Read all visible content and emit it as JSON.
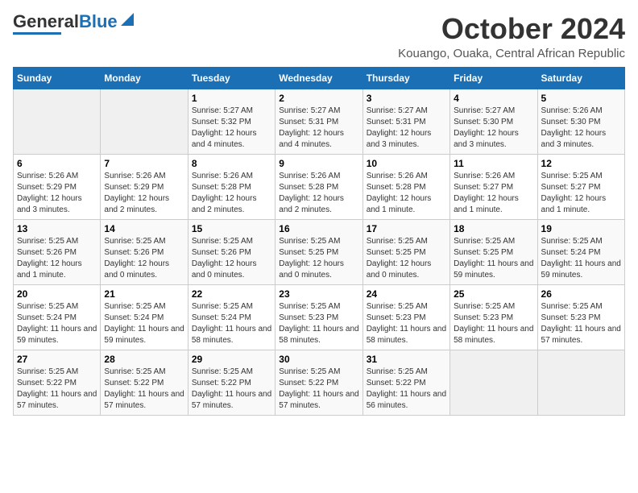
{
  "logo": {
    "general": "General",
    "blue": "Blue"
  },
  "header": {
    "month_title": "October 2024",
    "location": "Kouango, Ouaka, Central African Republic"
  },
  "days_of_week": [
    "Sunday",
    "Monday",
    "Tuesday",
    "Wednesday",
    "Thursday",
    "Friday",
    "Saturday"
  ],
  "weeks": [
    [
      {
        "day": "",
        "info": ""
      },
      {
        "day": "",
        "info": ""
      },
      {
        "day": "1",
        "info": "Sunrise: 5:27 AM\nSunset: 5:32 PM\nDaylight: 12 hours and 4 minutes."
      },
      {
        "day": "2",
        "info": "Sunrise: 5:27 AM\nSunset: 5:31 PM\nDaylight: 12 hours and 4 minutes."
      },
      {
        "day": "3",
        "info": "Sunrise: 5:27 AM\nSunset: 5:31 PM\nDaylight: 12 hours and 3 minutes."
      },
      {
        "day": "4",
        "info": "Sunrise: 5:27 AM\nSunset: 5:30 PM\nDaylight: 12 hours and 3 minutes."
      },
      {
        "day": "5",
        "info": "Sunrise: 5:26 AM\nSunset: 5:30 PM\nDaylight: 12 hours and 3 minutes."
      }
    ],
    [
      {
        "day": "6",
        "info": "Sunrise: 5:26 AM\nSunset: 5:29 PM\nDaylight: 12 hours and 3 minutes."
      },
      {
        "day": "7",
        "info": "Sunrise: 5:26 AM\nSunset: 5:29 PM\nDaylight: 12 hours and 2 minutes."
      },
      {
        "day": "8",
        "info": "Sunrise: 5:26 AM\nSunset: 5:28 PM\nDaylight: 12 hours and 2 minutes."
      },
      {
        "day": "9",
        "info": "Sunrise: 5:26 AM\nSunset: 5:28 PM\nDaylight: 12 hours and 2 minutes."
      },
      {
        "day": "10",
        "info": "Sunrise: 5:26 AM\nSunset: 5:28 PM\nDaylight: 12 hours and 1 minute."
      },
      {
        "day": "11",
        "info": "Sunrise: 5:26 AM\nSunset: 5:27 PM\nDaylight: 12 hours and 1 minute."
      },
      {
        "day": "12",
        "info": "Sunrise: 5:25 AM\nSunset: 5:27 PM\nDaylight: 12 hours and 1 minute."
      }
    ],
    [
      {
        "day": "13",
        "info": "Sunrise: 5:25 AM\nSunset: 5:26 PM\nDaylight: 12 hours and 1 minute."
      },
      {
        "day": "14",
        "info": "Sunrise: 5:25 AM\nSunset: 5:26 PM\nDaylight: 12 hours and 0 minutes."
      },
      {
        "day": "15",
        "info": "Sunrise: 5:25 AM\nSunset: 5:26 PM\nDaylight: 12 hours and 0 minutes."
      },
      {
        "day": "16",
        "info": "Sunrise: 5:25 AM\nSunset: 5:25 PM\nDaylight: 12 hours and 0 minutes."
      },
      {
        "day": "17",
        "info": "Sunrise: 5:25 AM\nSunset: 5:25 PM\nDaylight: 12 hours and 0 minutes."
      },
      {
        "day": "18",
        "info": "Sunrise: 5:25 AM\nSunset: 5:25 PM\nDaylight: 11 hours and 59 minutes."
      },
      {
        "day": "19",
        "info": "Sunrise: 5:25 AM\nSunset: 5:24 PM\nDaylight: 11 hours and 59 minutes."
      }
    ],
    [
      {
        "day": "20",
        "info": "Sunrise: 5:25 AM\nSunset: 5:24 PM\nDaylight: 11 hours and 59 minutes."
      },
      {
        "day": "21",
        "info": "Sunrise: 5:25 AM\nSunset: 5:24 PM\nDaylight: 11 hours and 59 minutes."
      },
      {
        "day": "22",
        "info": "Sunrise: 5:25 AM\nSunset: 5:24 PM\nDaylight: 11 hours and 58 minutes."
      },
      {
        "day": "23",
        "info": "Sunrise: 5:25 AM\nSunset: 5:23 PM\nDaylight: 11 hours and 58 minutes."
      },
      {
        "day": "24",
        "info": "Sunrise: 5:25 AM\nSunset: 5:23 PM\nDaylight: 11 hours and 58 minutes."
      },
      {
        "day": "25",
        "info": "Sunrise: 5:25 AM\nSunset: 5:23 PM\nDaylight: 11 hours and 58 minutes."
      },
      {
        "day": "26",
        "info": "Sunrise: 5:25 AM\nSunset: 5:23 PM\nDaylight: 11 hours and 57 minutes."
      }
    ],
    [
      {
        "day": "27",
        "info": "Sunrise: 5:25 AM\nSunset: 5:22 PM\nDaylight: 11 hours and 57 minutes."
      },
      {
        "day": "28",
        "info": "Sunrise: 5:25 AM\nSunset: 5:22 PM\nDaylight: 11 hours and 57 minutes."
      },
      {
        "day": "29",
        "info": "Sunrise: 5:25 AM\nSunset: 5:22 PM\nDaylight: 11 hours and 57 minutes."
      },
      {
        "day": "30",
        "info": "Sunrise: 5:25 AM\nSunset: 5:22 PM\nDaylight: 11 hours and 57 minutes."
      },
      {
        "day": "31",
        "info": "Sunrise: 5:25 AM\nSunset: 5:22 PM\nDaylight: 11 hours and 56 minutes."
      },
      {
        "day": "",
        "info": ""
      },
      {
        "day": "",
        "info": ""
      }
    ]
  ]
}
